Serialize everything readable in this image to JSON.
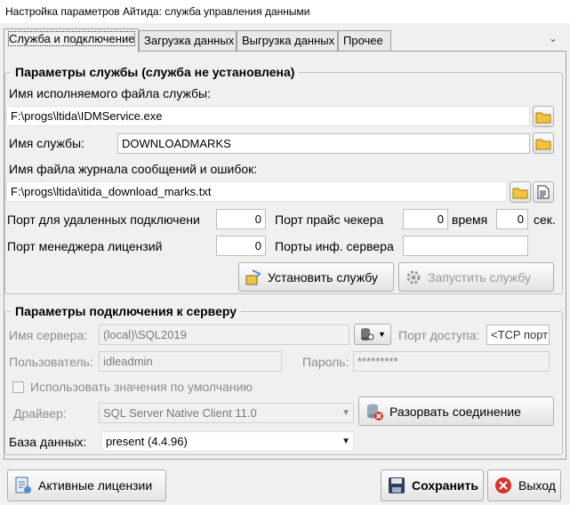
{
  "window": {
    "title": "Настройка параметров Айтида: служба управления данными"
  },
  "tabs": [
    {
      "label": "Служба и подключение"
    },
    {
      "label": "Загрузка данных"
    },
    {
      "label": "Выгрузка данных"
    },
    {
      "label": "Прочее"
    }
  ],
  "service": {
    "legend": "Параметры службы (служба не установлена)",
    "exe_label": "Имя исполняемого файла службы:",
    "exe_value": "F:\\progs\\ltida\\IDMService.exe",
    "name_label": "Имя службы:",
    "name_value": "DOWNLOADMARKS",
    "log_label": "Имя файла журнала сообщений и ошибок:",
    "log_value": "F:\\progs\\ltida\\itida_download_marks.txt",
    "remote_port_label": "Порт для удаленных подключени",
    "remote_port_value": "0",
    "price_port_label": "Порт прайс чекера",
    "price_port_value": "0",
    "time_label": "время",
    "time_value": "0",
    "sec_label": "сек.",
    "license_port_label": "Порт менеджера лицензий",
    "license_port_value": "0",
    "info_ports_label": "Порты инф. сервера",
    "info_ports_value": "",
    "install_button": "Установить службу",
    "start_button": "Запустить службу"
  },
  "connection": {
    "legend": "Параметры подключения к серверу",
    "server_label": "Имя сервера:",
    "server_value": "(local)\\SQL2019",
    "port_label": "Порт доступа:",
    "port_value": "<TCP порт",
    "user_label": "Пользователь:",
    "user_value": "idleadmin",
    "password_label": "Пароль:",
    "password_value": "*********",
    "default_checkbox_label": "Использовать значения по умолчанию",
    "driver_label": "Драйвер:",
    "driver_value": "SQL Server Native Client 11.0",
    "disconnect_button": "Разорвать соединение",
    "db_label": "База данных:",
    "db_value": "present (4.4.96)"
  },
  "footer": {
    "licenses_button": "Активные лицензии",
    "save_button": "Сохранить",
    "exit_button": "Выход"
  }
}
